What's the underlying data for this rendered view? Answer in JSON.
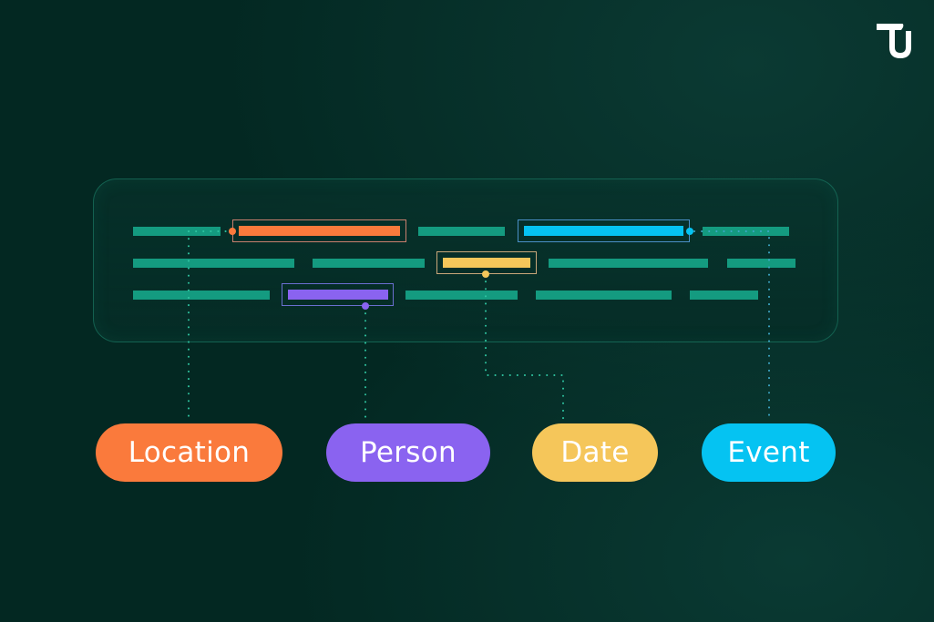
{
  "brand": {
    "logo_icon": "tu-monogram-logo"
  },
  "colors": {
    "background": "#032822",
    "text_line": "#149b80",
    "connector": "#2fc4a0",
    "location": "#fa7a3c",
    "person": "#8a63f0",
    "date": "#f5c65a",
    "event": "#05c3f2"
  },
  "text_rows": [
    {
      "segments": [
        "plain",
        "location",
        "plain",
        "event",
        "plain"
      ]
    },
    {
      "segments": [
        "plain",
        "plain",
        "date",
        "plain",
        "plain"
      ]
    },
    {
      "segments": [
        "plain",
        "person",
        "plain",
        "plain",
        "plain"
      ]
    }
  ],
  "entity_labels": {
    "location": "Location",
    "person": "Person",
    "date": "Date",
    "event": "Event"
  }
}
